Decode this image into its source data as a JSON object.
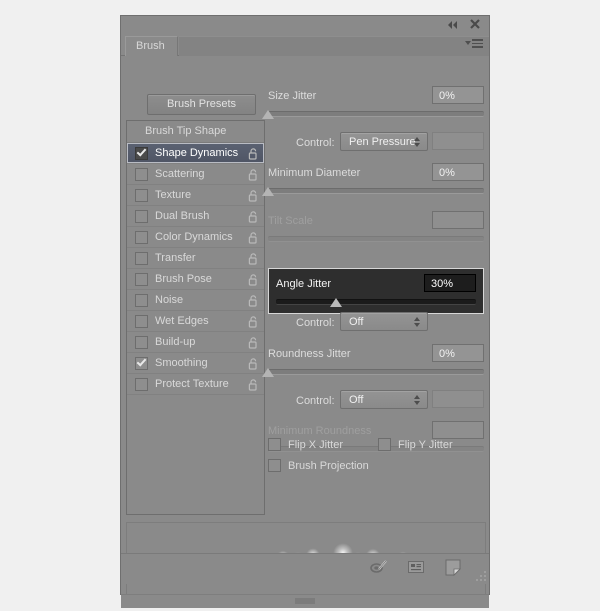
{
  "window": {
    "collapse_icon": "double-chevron-left-icon",
    "close_icon": "close-icon",
    "menu_icon": "panel-menu-icon"
  },
  "tab": {
    "label": "Brush"
  },
  "presets_button": {
    "label": "Brush Presets"
  },
  "sidebar": {
    "header": "Brush Tip Shape",
    "items": [
      {
        "label": "Shape Dynamics",
        "checked": true,
        "selected": true,
        "locked": false
      },
      {
        "label": "Scattering",
        "checked": false,
        "selected": false,
        "locked": false
      },
      {
        "label": "Texture",
        "checked": false,
        "selected": false,
        "locked": false
      },
      {
        "label": "Dual Brush",
        "checked": false,
        "selected": false,
        "locked": false
      },
      {
        "label": "Color Dynamics",
        "checked": false,
        "selected": false,
        "locked": false
      },
      {
        "label": "Transfer",
        "checked": false,
        "selected": false,
        "locked": false
      },
      {
        "label": "Brush Pose",
        "checked": false,
        "selected": false,
        "locked": false
      },
      {
        "label": "Noise",
        "checked": false,
        "selected": false,
        "locked": false
      },
      {
        "label": "Wet Edges",
        "checked": false,
        "selected": false,
        "locked": false
      },
      {
        "label": "Build-up",
        "checked": false,
        "selected": false,
        "locked": false
      },
      {
        "label": "Smoothing",
        "checked": true,
        "selected": false,
        "locked": false
      },
      {
        "label": "Protect Texture",
        "checked": false,
        "selected": false,
        "locked": false
      }
    ]
  },
  "controls": {
    "size_jitter": {
      "label": "Size Jitter",
      "value": "0%",
      "slider_pct": 0
    },
    "size_control": {
      "label": "Control:",
      "value": "Pen Pressure"
    },
    "minimum_diameter": {
      "label": "Minimum Diameter",
      "value": "0%",
      "slider_pct": 0
    },
    "tilt_scale": {
      "label": "Tilt Scale",
      "value": "",
      "disabled": true
    },
    "angle_jitter": {
      "label": "Angle Jitter",
      "value": "30%",
      "slider_pct": 30,
      "highlighted": true
    },
    "angle_control": {
      "label": "Control:",
      "value": "Off"
    },
    "roundness_jitter": {
      "label": "Roundness Jitter",
      "value": "0%",
      "slider_pct": 0
    },
    "roundness_control": {
      "label": "Control:",
      "value": "Off"
    },
    "minimum_roundness": {
      "label": "Minimum Roundness",
      "value": "",
      "disabled": true
    },
    "flip_x": {
      "label": "Flip X Jitter",
      "checked": false
    },
    "flip_y": {
      "label": "Flip Y Jitter",
      "checked": false
    },
    "brush_projection": {
      "label": "Brush Projection",
      "checked": false
    }
  },
  "footer": {
    "icons": [
      {
        "name": "toggle-brush-preview-icon"
      },
      {
        "name": "create-new-preset-icon"
      },
      {
        "name": "new-brush-icon"
      }
    ],
    "resize_grip": "resize-grip-icon"
  },
  "colors": {
    "panel_bg": "#8a8a8a",
    "selection_blue": "#5b6272",
    "highlight_dark": "#2e2e2e",
    "text": "#d9d9d9",
    "app_bg": "#f0f0f0"
  },
  "preview": {
    "label": "brush-stroke-preview",
    "dots": [
      [
        22,
        56,
        1.4
      ],
      [
        28,
        52,
        1.2
      ],
      [
        33,
        57,
        1.0
      ],
      [
        38,
        49,
        1.6
      ],
      [
        41,
        55,
        1.2
      ],
      [
        45,
        45,
        1.3
      ],
      [
        50,
        52,
        1.1
      ],
      [
        54,
        47,
        1.8
      ],
      [
        58,
        55,
        1.2
      ],
      [
        62,
        43,
        1.4
      ],
      [
        66,
        50,
        2.0
      ],
      [
        70,
        46,
        1.2
      ],
      [
        74,
        53,
        1.5
      ],
      [
        78,
        41,
        1.3
      ],
      [
        82,
        48,
        2.4
      ],
      [
        86,
        54,
        1.2
      ],
      [
        90,
        44,
        1.6
      ],
      [
        95,
        50,
        1.4
      ],
      [
        99,
        38,
        2.0
      ],
      [
        104,
        47,
        1.3
      ],
      [
        108,
        53,
        1.5
      ],
      [
        112,
        41,
        2.6
      ],
      [
        117,
        49,
        1.4
      ],
      [
        121,
        57,
        1.2
      ],
      [
        126,
        36,
        2.2
      ],
      [
        131,
        45,
        1.6
      ],
      [
        136,
        52,
        2.0
      ],
      [
        141,
        40,
        1.4
      ],
      [
        146,
        48,
        3.0
      ],
      [
        151,
        56,
        1.5
      ],
      [
        156,
        34,
        2.4
      ],
      [
        161,
        43,
        1.7
      ],
      [
        166,
        51,
        2.2
      ],
      [
        171,
        38,
        3.4
      ],
      [
        176,
        46,
        1.6
      ],
      [
        181,
        54,
        1.9
      ],
      [
        186,
        32,
        2.6
      ],
      [
        191,
        41,
        2.1
      ],
      [
        196,
        49,
        3.6
      ],
      [
        201,
        36,
        1.8
      ],
      [
        206,
        44,
        2.3
      ],
      [
        211,
        52,
        2.0
      ],
      [
        216,
        30,
        3.8
      ],
      [
        221,
        39,
        2.0
      ],
      [
        226,
        47,
        2.5
      ],
      [
        231,
        35,
        2.2
      ],
      [
        236,
        43,
        3.2
      ],
      [
        241,
        51,
        1.9
      ],
      [
        246,
        33,
        2.8
      ],
      [
        251,
        42,
        2.4
      ],
      [
        256,
        50,
        3.0
      ],
      [
        261,
        37,
        2.1
      ],
      [
        266,
        45,
        2.6
      ],
      [
        271,
        53,
        2.2
      ],
      [
        276,
        35,
        2.4
      ],
      [
        281,
        44,
        3.2
      ],
      [
        286,
        52,
        2.0
      ],
      [
        291,
        39,
        2.6
      ],
      [
        296,
        47,
        2.3
      ],
      [
        301,
        55,
        1.8
      ],
      [
        306,
        41,
        2.2
      ],
      [
        311,
        49,
        2.8
      ],
      [
        316,
        43,
        1.9
      ],
      [
        321,
        51,
        2.4
      ],
      [
        326,
        45,
        1.7
      ],
      [
        331,
        53,
        2.0
      ],
      [
        336,
        47,
        1.5
      ],
      [
        341,
        55,
        1.8
      ],
      [
        346,
        49,
        1.3
      ],
      [
        351,
        57,
        1.5
      ]
    ]
  }
}
